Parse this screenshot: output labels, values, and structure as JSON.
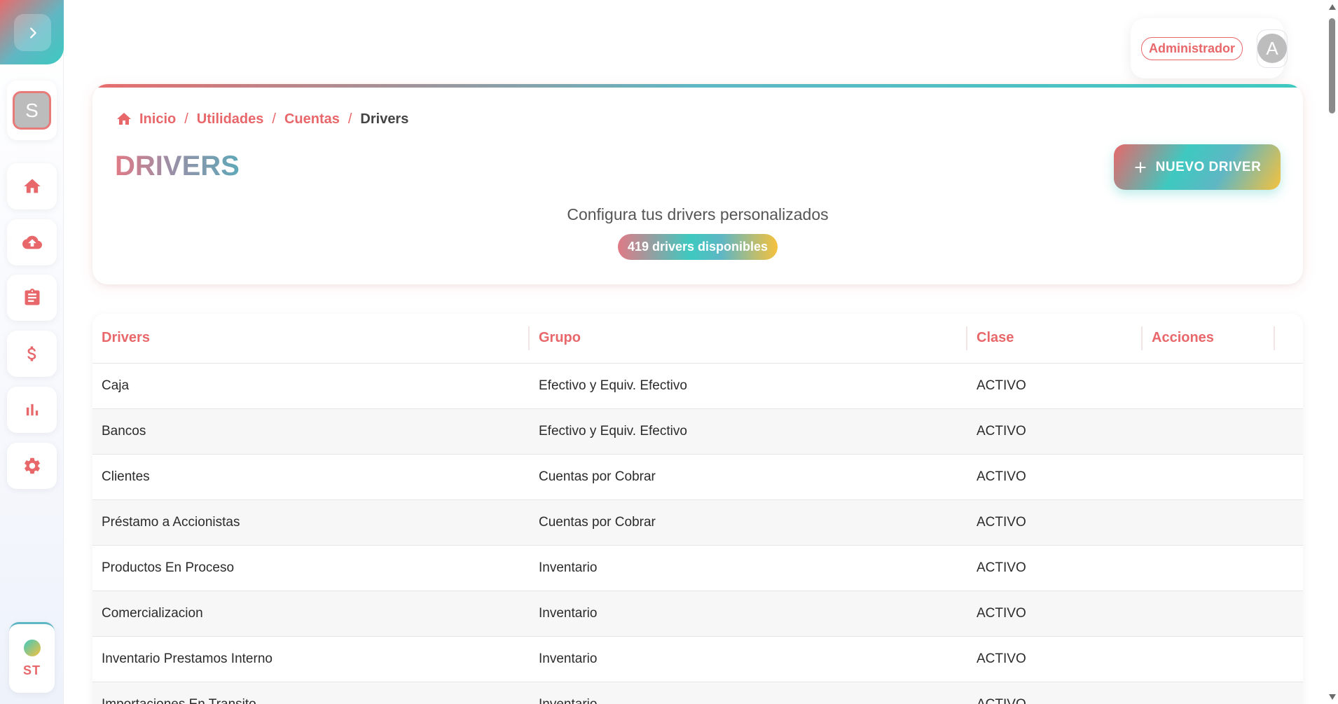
{
  "sidebar": {
    "toggle_icon": "chevron-right-icon",
    "user_initial": "S",
    "nav_icons": [
      "home-icon",
      "cloud-upload-icon",
      "clipboard-icon",
      "dollar-icon",
      "bar-chart-icon",
      "gear-icon"
    ],
    "brand_text": "ST"
  },
  "topbar": {
    "role": "Administrador",
    "avatar_initial": "A"
  },
  "breadcrumb": {
    "items": [
      "Inicio",
      "Utilidades",
      "Cuentas"
    ],
    "current": "Drivers"
  },
  "header": {
    "title": "DRIVERS",
    "new_button_label": "NUEVO DRIVER",
    "subtitle": "Configura tus drivers personalizados",
    "count_label": "419 drivers disponibles"
  },
  "table": {
    "columns": [
      "Drivers",
      "Grupo",
      "Clase",
      "Acciones"
    ],
    "rows": [
      [
        "Caja",
        "Efectivo y Equiv. Efectivo",
        "ACTIVO"
      ],
      [
        "Bancos",
        "Efectivo y Equiv. Efectivo",
        "ACTIVO"
      ],
      [
        "Clientes",
        "Cuentas por Cobrar",
        "ACTIVO"
      ],
      [
        "Préstamo a Accionistas",
        "Cuentas por Cobrar",
        "ACTIVO"
      ],
      [
        "Productos En Proceso",
        "Inventario",
        "ACTIVO"
      ],
      [
        "Comercializacion",
        "Inventario",
        "ACTIVO"
      ],
      [
        "Inventario Prestamos Interno",
        "Inventario",
        "ACTIVO"
      ],
      [
        "Importaciones En Transito",
        "Inventario",
        "ACTIVO"
      ]
    ]
  },
  "colors": {
    "accent": "#e8676a",
    "teal": "#3ec9c0",
    "yellow": "#f6c13c"
  }
}
